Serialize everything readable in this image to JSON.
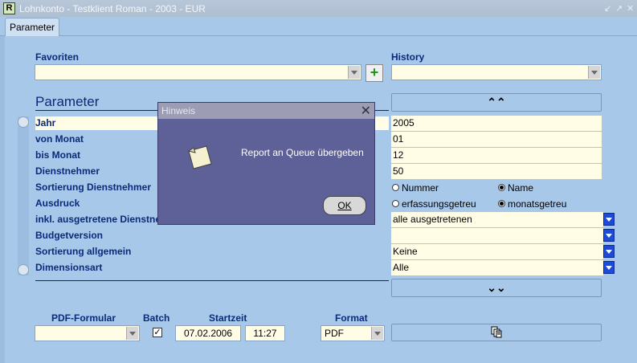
{
  "window": {
    "title": "Lohnkonto - Testklient Roman - 2003 - EUR",
    "app_icon": "R",
    "controls": [
      "↙",
      "↗",
      "✕"
    ]
  },
  "tabs": [
    {
      "label": "Parameter"
    }
  ],
  "favoriten": {
    "label": "Favoriten",
    "value": "",
    "add_icon": "+"
  },
  "history": {
    "label": "History",
    "value": ""
  },
  "section": {
    "title": "Parameter"
  },
  "params": [
    {
      "label": "Jahr",
      "value": "2005"
    },
    {
      "label": "von Monat",
      "value": "01"
    },
    {
      "label": "bis Monat",
      "value": "12"
    },
    {
      "label": "Dienstnehmer",
      "value": "50"
    },
    {
      "label": "Sortierung Dienstnehmer",
      "radio": [
        {
          "label": "Nummer",
          "checked": false
        },
        {
          "label": "Name",
          "checked": true
        }
      ]
    },
    {
      "label": "Ausdruck",
      "radio": [
        {
          "label": "erfassungsgetreu",
          "checked": false
        },
        {
          "label": "monatsgetreu",
          "checked": true
        }
      ]
    },
    {
      "label": "inkl. ausgetretene Dienstnehmer",
      "value": "alle ausgetretenen"
    },
    {
      "label": "Budgetversion",
      "value": ""
    },
    {
      "label": "Sortierung allgemein",
      "value": "Keine"
    },
    {
      "label": "Dimensionsart",
      "value": "Alle"
    }
  ],
  "collapse_icon": "⌃⌃",
  "expand_icon": "⌄⌄",
  "footer": {
    "pdf_label": "PDF-Formular",
    "pdf_value": "",
    "batch_label": "Batch",
    "batch_checked": true,
    "startzeit_label": "Startzeit",
    "date": "07.02.2006",
    "time": "11:27",
    "format_label": "Format",
    "format_value": "PDF"
  },
  "dialog": {
    "title": "Hinweis",
    "close": "✕",
    "message": "Report an Queue übergeben",
    "ok_label": "OK"
  }
}
